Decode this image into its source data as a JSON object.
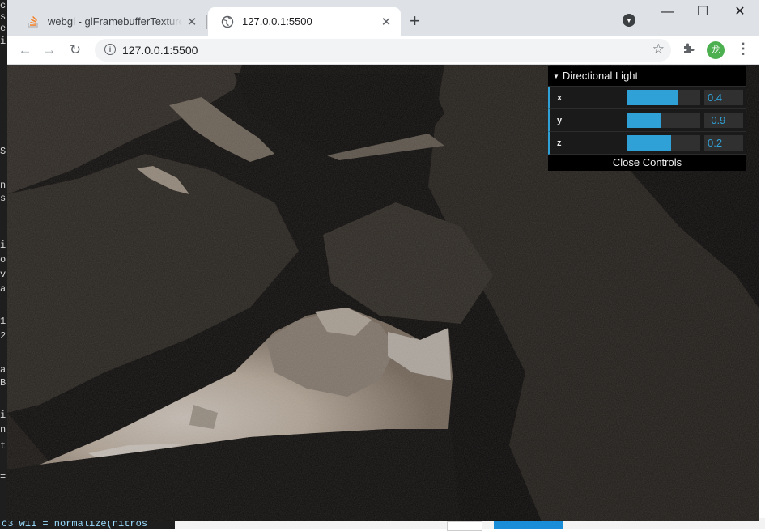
{
  "browser": {
    "tabs": [
      {
        "title": "webgl - glFramebufferTexture2D",
        "active": false
      },
      {
        "title": "127.0.0.1:5500",
        "active": true
      }
    ],
    "address": "127.0.0.1:5500",
    "profile_initial": "龙",
    "window_controls": {
      "minimize": "—",
      "maximize": "☐",
      "close": "✕"
    }
  },
  "gui": {
    "folder_title": "Directional Light",
    "controls": [
      {
        "label": "x",
        "value": "0.4",
        "fill": 0.7
      },
      {
        "label": "y",
        "value": "-0.9",
        "fill": 0.45
      },
      {
        "label": "z",
        "value": "0.2",
        "fill": 0.6
      }
    ],
    "close_label": "Close Controls"
  },
  "background": {
    "editor_bottom_text": "c3 w11 = normalize(nitros",
    "left_letters": [
      "c",
      "s",
      "e",
      "i",
      "S",
      "n",
      "s",
      "i",
      "o",
      "v",
      "a",
      "1",
      "2",
      "a",
      "B",
      "i",
      "n",
      "t",
      "="
    ]
  },
  "colors": {
    "accent": "#2fa1d6",
    "avatar": "#4caf50"
  }
}
